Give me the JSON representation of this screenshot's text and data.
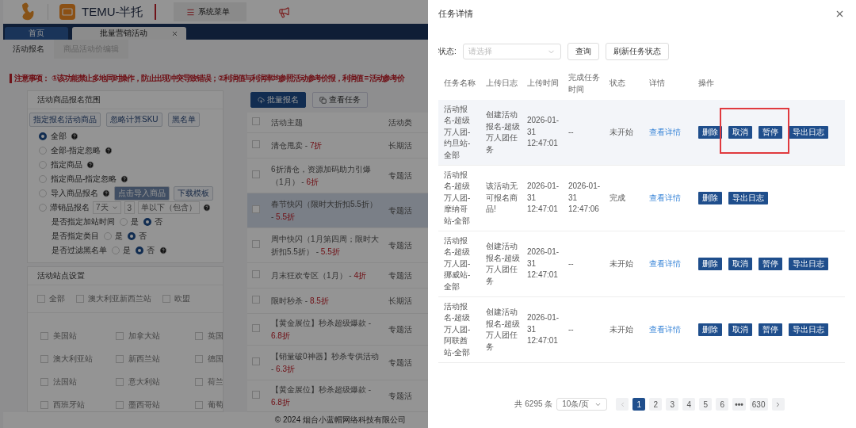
{
  "header": {
    "brand": "TEMU-半托",
    "menu_button": "系统菜单"
  },
  "tabs": [
    {
      "label": "首页",
      "selected": false,
      "closable": false
    },
    {
      "label": "批量营销活动",
      "selected": true,
      "closable": true
    }
  ],
  "sub_tabs": [
    {
      "label": "活动报名",
      "selected": true
    },
    {
      "label": "商品活动价编辑",
      "selected": false
    }
  ],
  "notice": {
    "label": "注意事项：",
    "text": "①该功能禁止多地同时操作，防止出现冲突导致错误；②利润值与利润率均参照活动参考价报，利润值 = 活动参考价"
  },
  "scope_panel": {
    "title": "活动商品报名范围",
    "buttons": [
      "指定报名活动商品",
      "忽略计算SKU",
      "黑名单"
    ],
    "options": [
      {
        "kind": "plain",
        "label": "全部",
        "selected": true,
        "help": true
      },
      {
        "kind": "plain",
        "label": "全部-指定忽略",
        "selected": false,
        "help": true
      },
      {
        "kind": "plain",
        "label": "指定商品",
        "selected": false,
        "help": true
      },
      {
        "kind": "plain",
        "label": "指定商品-指定忽略",
        "selected": false,
        "help": true
      },
      {
        "kind": "import",
        "label": "导入商品报名",
        "selected": false,
        "help": true,
        "actions": [
          {
            "label": "点击导入商品",
            "disabled": true
          },
          {
            "label": "下载模板",
            "disabled": false
          }
        ]
      },
      {
        "kind": "slow",
        "label": "滞销品报名",
        "selected": false,
        "help": true,
        "period": "7天",
        "count": "3",
        "unit": "单以下（包含）"
      }
    ],
    "switches": [
      {
        "label": "是否指定加站时间",
        "help": false,
        "choices": [
          {
            "label": "是",
            "selected": false
          },
          {
            "label": "否",
            "selected": true
          }
        ]
      },
      {
        "label": "是否指定类目",
        "help": false,
        "choices": [
          {
            "label": "是",
            "selected": false
          },
          {
            "label": "否",
            "selected": true
          }
        ]
      },
      {
        "label": "是否过滤黑名单",
        "help": true,
        "choices": [
          {
            "label": "是",
            "selected": false
          },
          {
            "label": "否",
            "selected": true
          }
        ]
      }
    ]
  },
  "sites_panel": {
    "title": "活动站点设置",
    "groups": [
      {
        "label": "全部",
        "checked": false
      },
      {
        "label": "澳大利亚新西兰站",
        "checked": false
      },
      {
        "label": "欧盟",
        "checked": false
      }
    ],
    "sites": [
      {
        "label": "美国站",
        "checked": false
      },
      {
        "label": "加拿大站",
        "checked": false
      },
      {
        "label": "英国",
        "checked": false
      },
      {
        "label": "澳大利亚站",
        "checked": false
      },
      {
        "label": "新西兰站",
        "checked": false
      },
      {
        "label": "德国",
        "checked": false
      },
      {
        "label": "法国站",
        "checked": false
      },
      {
        "label": "意大利站",
        "checked": false
      },
      {
        "label": "荷兰",
        "checked": false
      },
      {
        "label": "西班牙站",
        "checked": false
      },
      {
        "label": "墨西哥站",
        "checked": false
      },
      {
        "label": "葡萄",
        "checked": false
      }
    ]
  },
  "activities": {
    "all_checked": false,
    "buttons": [
      {
        "label": "批量报名",
        "kind": "primary"
      },
      {
        "label": "查看任务",
        "kind": "default"
      }
    ],
    "columns": [
      "活动主题",
      "活动类"
    ],
    "rows": [
      {
        "topic": "清仓甩卖 - **7折**",
        "type": "长期活",
        "checked": false,
        "hovered": false
      },
      {
        "topic": "6折清仓，资源加码助力引爆（1月） - **6折**",
        "type": "专题活",
        "checked": false,
        "hovered": false
      },
      {
        "topic": "春节快闪（限时大折扣5.5折） - **5.5折**",
        "type": "专题活",
        "checked": false,
        "hovered": true
      },
      {
        "topic": "周中快闪（1月第四周；限时大折扣5.5折） - **5.5折**",
        "type": "专题活",
        "checked": false,
        "hovered": false
      },
      {
        "topic": "月末狂欢专区（1月） - **4折**",
        "type": "专题活",
        "checked": false,
        "hovered": false
      },
      {
        "topic": "限时秒杀 - **8.5折**",
        "type": "长期活",
        "checked": false,
        "hovered": false
      },
      {
        "topic": "【黄金展位】秒杀超级爆款 - **6.8折**",
        "type": "专题活",
        "checked": false,
        "hovered": false
      },
      {
        "topic": "【销量破0神器】秒杀专供活动 - **6.3折**",
        "type": "专题活",
        "checked": false,
        "hovered": false
      },
      {
        "topic": "【黄金展位】秒杀超级爆款 - **6.8折**",
        "type": "专题活",
        "checked": false,
        "hovered": false
      }
    ]
  },
  "footer": "© 2024 烟台小蓝帽网络科技有限公司",
  "drawer": {
    "title": "任务详情",
    "filter": {
      "label": "状态:",
      "placeholder": "请选择",
      "buttons": [
        "查询",
        "刷新任务状态"
      ]
    },
    "columns": [
      "任务名称",
      "上传日志",
      "上传时间",
      "完成任务时间",
      "状态",
      "详情",
      "操作"
    ],
    "rows": [
      {
        "name": "活动报名-超级万人团-约旦站-全部",
        "log": "创建活动报名-超级万人团任务",
        "uploaded": "2026-01-31 12:47:01",
        "finished": "--",
        "status": "未开始",
        "detail": "查看详情",
        "hovered": true,
        "actions": [
          {
            "label": "删除",
            "boxed": false
          },
          {
            "label": "取消",
            "boxed": true
          },
          {
            "label": "暂停",
            "boxed": true
          },
          {
            "label": "导出日志",
            "boxed": false
          }
        ]
      },
      {
        "name": "活动报名-超级万人团-摩纳哥站-全部",
        "log": "该活动无可报名商品!",
        "uploaded": "2026-01-31 12:47:01",
        "finished": "2026-01-31 12:47:06",
        "status": "完成",
        "detail": "查看详情",
        "hovered": false,
        "actions": [
          {
            "label": "删除",
            "boxed": false
          },
          {
            "label": "导出日志",
            "boxed": false
          }
        ]
      },
      {
        "name": "活动报名-超级万人团-挪威站-全部",
        "log": "创建活动报名-超级万人团任务",
        "uploaded": "2026-01-31 12:47:01",
        "finished": "--",
        "status": "未开始",
        "detail": "查看详情",
        "hovered": false,
        "actions": [
          {
            "label": "删除",
            "boxed": false
          },
          {
            "label": "取消",
            "boxed": false
          },
          {
            "label": "暂停",
            "boxed": false
          },
          {
            "label": "导出日志",
            "boxed": false
          }
        ]
      },
      {
        "name": "活动报名-超级万人团-阿联酋站-全部",
        "log": "创建活动报名-超级万人团任务",
        "uploaded": "2026-01-31 12:47:01",
        "finished": "--",
        "status": "未开始",
        "detail": "查看详情",
        "hovered": false,
        "actions": [
          {
            "label": "删除",
            "boxed": false
          },
          {
            "label": "取消",
            "boxed": false
          },
          {
            "label": "暂停",
            "boxed": false
          },
          {
            "label": "导出日志",
            "boxed": false
          }
        ]
      }
    ],
    "pagination": {
      "total": "共 6295 条",
      "page_size": "10条/页",
      "pages": [
        {
          "kind": "page",
          "label": "1",
          "selected": true
        },
        {
          "kind": "page",
          "label": "2",
          "selected": false
        },
        {
          "kind": "page",
          "label": "3",
          "selected": false
        },
        {
          "kind": "page",
          "label": "4",
          "selected": false
        },
        {
          "kind": "page",
          "label": "5",
          "selected": false
        },
        {
          "kind": "page",
          "label": "6",
          "selected": false
        },
        {
          "kind": "more",
          "label": "•••",
          "selected": false
        },
        {
          "kind": "page",
          "label": "630",
          "selected": false
        }
      ]
    }
  }
}
